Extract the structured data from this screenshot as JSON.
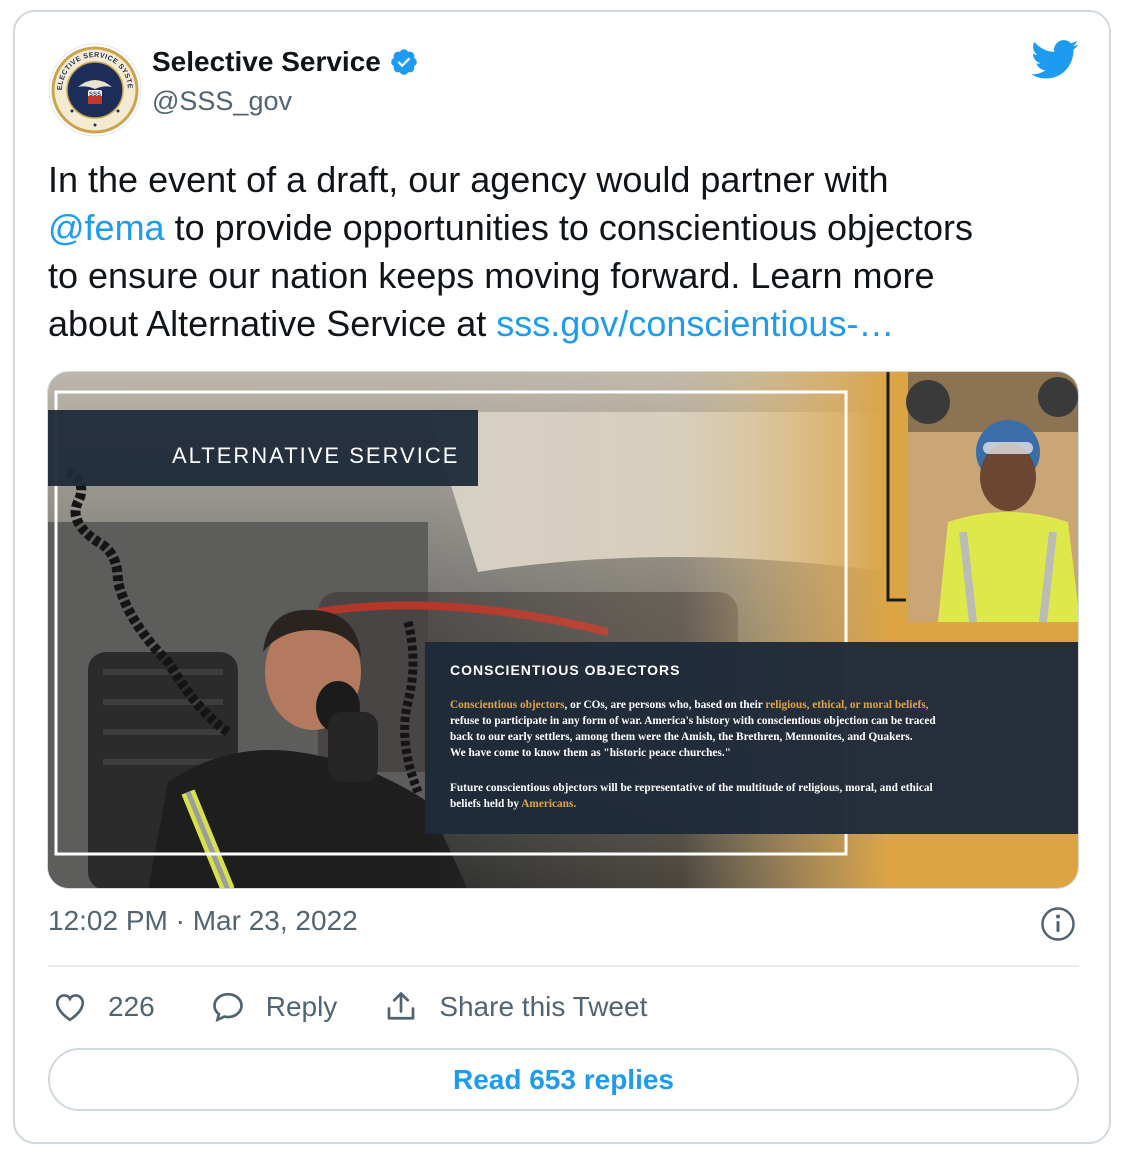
{
  "account": {
    "name": "Selective Service",
    "handle": "@SSS_gov",
    "seal_text": "SELECTIVE SERVICE SYSTEM",
    "seal_badge": "SSS"
  },
  "icons": {
    "verified": "verified-badge-icon",
    "platform": "twitter-bird-icon",
    "info": "info-icon",
    "like": "heart-icon",
    "reply": "speech-bubble-icon",
    "share": "share-upload-icon"
  },
  "colors": {
    "brand_blue": "#1d9bf0",
    "text": "#0f1419",
    "muted": "#536471",
    "overlay_navy": "#1f2a3a",
    "gold": "#e0a447",
    "panel_orange": "#dca442"
  },
  "tweet": {
    "text_part1": "In the event of a draft, our agency would partner with",
    "mention": "@fema",
    "text_part2": " to provide opportunities to conscientious objectors",
    "text_part3": "to ensure our nation keeps moving forward. Learn more",
    "text_part4": "about Alternative Service at ",
    "link": "sss.gov/conscientious-…"
  },
  "media": {
    "banner_title": "ALTERNATIVE SERVICE",
    "heading": "CONSCIENTIOUS OBJECTORS",
    "p1_l1_gold1": "Conscientious objectors",
    "p1_l1_plain": ", or COs, are persons who, based on their ",
    "p1_l1_gold2": "religious, ethical, or moral beliefs,",
    "p1_l2": "refuse to participate in any form of war.  America's history with conscientious objection can be traced",
    "p1_l3": "back to our early settlers, among them were the Amish, the Brethren,  Mennonites, and Quakers.",
    "p1_l4": "We have come to know them as \"historic peace churches.\"",
    "p2_l1": "Future conscientious objectors will be representative of the multitude of religious, moral, and ethical",
    "p2_l2_plain": "beliefs held by ",
    "p2_l2_gold": "Americans."
  },
  "meta": {
    "timestamp": "12:02 PM · Mar 23, 2022"
  },
  "actions": {
    "like_count": "226",
    "reply_label": "Reply",
    "share_label": "Share this Tweet"
  },
  "footer": {
    "read_replies": "Read 653 replies"
  }
}
